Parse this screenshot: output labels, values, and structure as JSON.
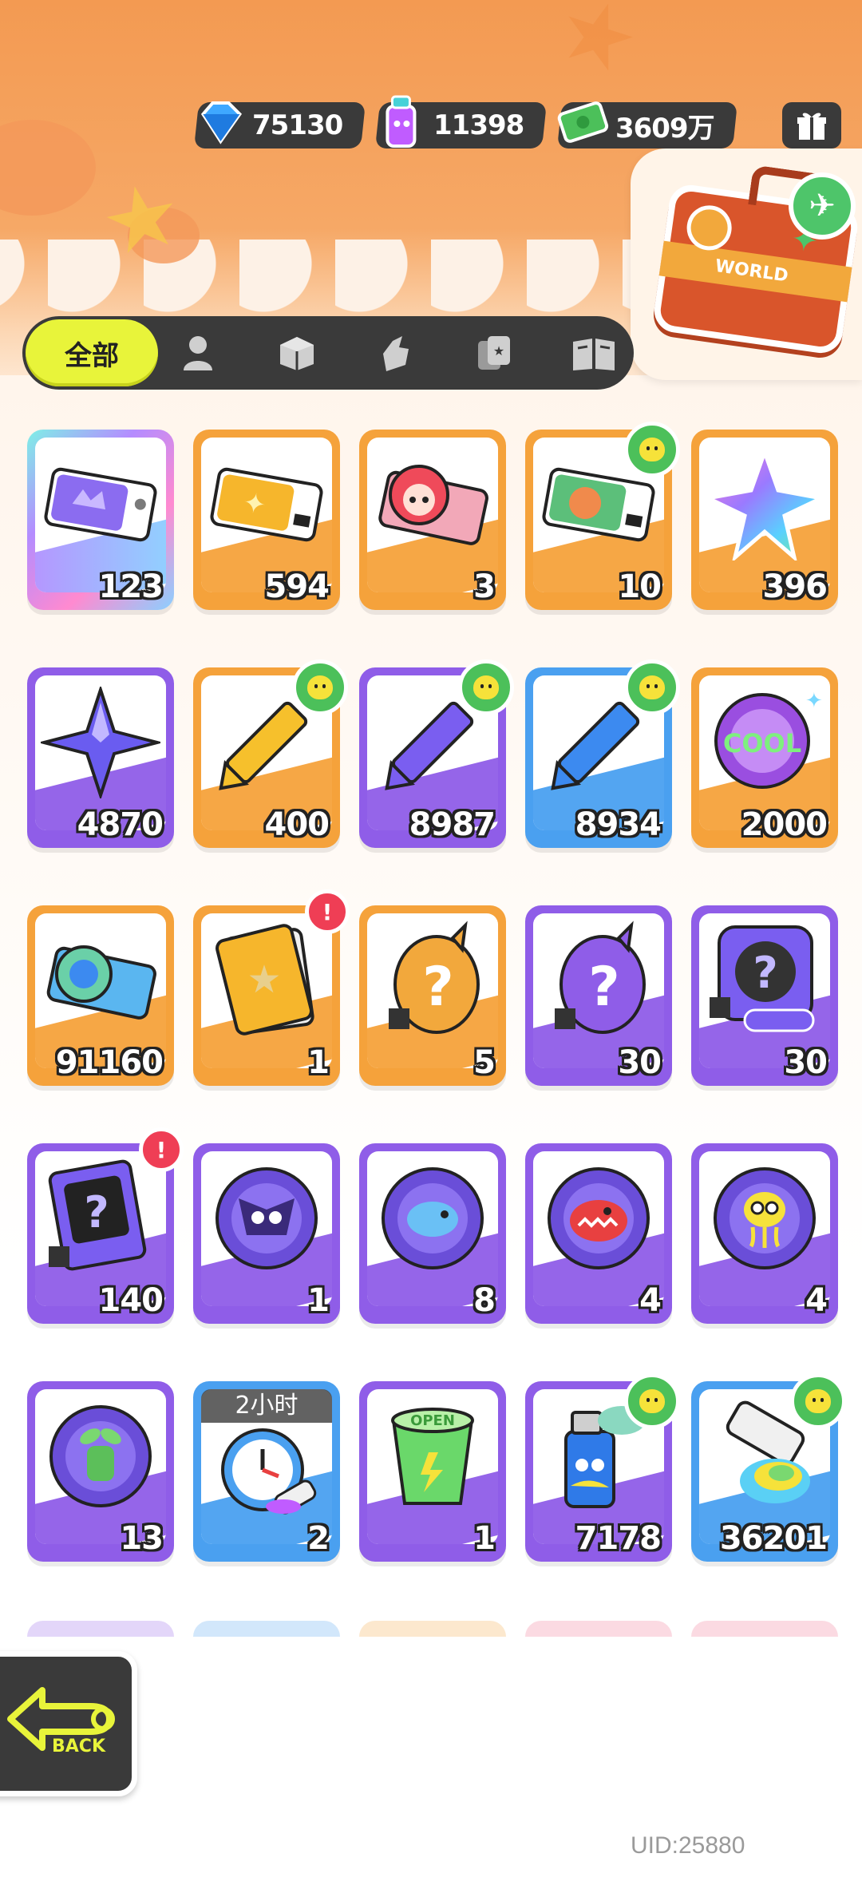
{
  "currencies": [
    {
      "name": "diamond-icon",
      "value": "75130",
      "color": "#3fa8ff"
    },
    {
      "name": "paint-can-icon",
      "value": "11398",
      "color": "#c05cff"
    },
    {
      "name": "cash-icon",
      "value": "3609万",
      "color": "#4cc05a"
    }
  ],
  "tabs": {
    "active_label": "全部",
    "items": [
      "character",
      "box",
      "hand",
      "cards",
      "book"
    ]
  },
  "world_button": {
    "label": "WORLD"
  },
  "items": [
    {
      "count": "123",
      "frame": "rainbow",
      "art": "purple-ticket"
    },
    {
      "count": "594",
      "frame": "orange",
      "art": "gold-ticket"
    },
    {
      "count": "3",
      "frame": "orange",
      "art": "character-ticket"
    },
    {
      "count": "10",
      "frame": "orange",
      "art": "green-ticket",
      "badge": "chick"
    },
    {
      "count": "396",
      "frame": "orange",
      "art": "rainbow-star"
    },
    {
      "count": "4870",
      "frame": "purple",
      "art": "purple-star"
    },
    {
      "count": "400",
      "frame": "orange",
      "art": "yellow-crayon",
      "badge": "chick"
    },
    {
      "count": "8987",
      "frame": "purple",
      "art": "purple-crayon",
      "badge": "chick"
    },
    {
      "count": "8934",
      "frame": "blue",
      "art": "blue-crayon",
      "badge": "chick"
    },
    {
      "count": "2000",
      "frame": "orange",
      "art": "cool-coin"
    },
    {
      "count": "91160",
      "frame": "orange",
      "art": "season-ticket"
    },
    {
      "count": "1",
      "frame": "orange",
      "art": "travel-card-gold",
      "badge": "alert"
    },
    {
      "count": "5",
      "frame": "orange",
      "art": "gold-mystery-egg"
    },
    {
      "count": "30",
      "frame": "purple",
      "art": "purple-mystery-egg"
    },
    {
      "count": "30",
      "frame": "purple",
      "art": "deity-mystery-coin"
    },
    {
      "count": "140",
      "frame": "purple",
      "art": "travel-card-mystery",
      "badge": "alert"
    },
    {
      "count": "1",
      "frame": "purple",
      "art": "bat-mpets-coin"
    },
    {
      "count": "8",
      "frame": "purple",
      "art": "fish-mpets-coin"
    },
    {
      "count": "4",
      "frame": "purple",
      "art": "shark-mpets-coin"
    },
    {
      "count": "4",
      "frame": "purple",
      "art": "jelly-mpets-coin"
    },
    {
      "count": "13",
      "frame": "purple",
      "art": "plant-mpets-coin"
    },
    {
      "count": "2",
      "frame": "blue",
      "art": "alarm-clock",
      "timer": "2小时"
    },
    {
      "count": "1",
      "frame": "purple",
      "art": "open-cup"
    },
    {
      "count": "7178",
      "frame": "purple",
      "art": "spray-can",
      "badge": "chick"
    },
    {
      "count": "36201",
      "frame": "blue",
      "art": "paint-tube",
      "badge": "chick"
    }
  ],
  "back_button": {
    "label": "BACK"
  },
  "uid": "UID:25880"
}
